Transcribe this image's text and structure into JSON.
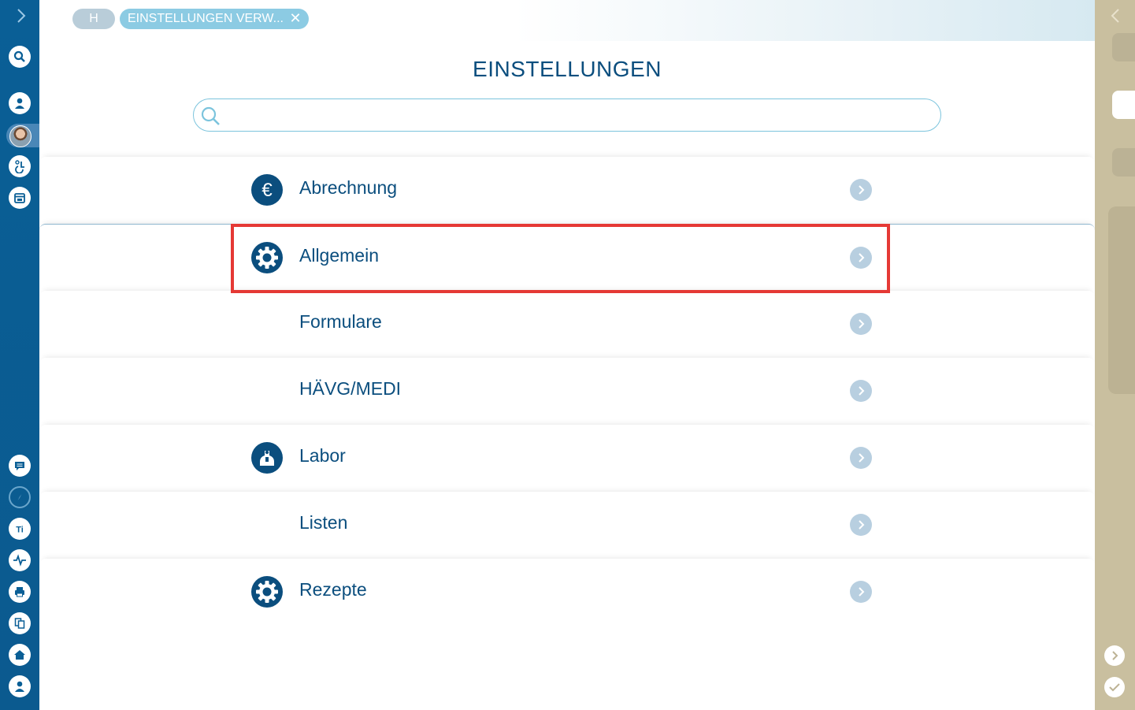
{
  "tabs": {
    "home_label": "H",
    "active_label": "EINSTELLUNGEN VERW...",
    "close_glyph": "✕"
  },
  "page": {
    "title": "EINSTELLUNGEN"
  },
  "search": {
    "value": "",
    "placeholder": ""
  },
  "settings_list": [
    {
      "label": "Abrechnung",
      "icon": "euro-icon"
    },
    {
      "label": "Allgemein",
      "icon": "gear-icon"
    },
    {
      "label": "Formulare",
      "icon": ""
    },
    {
      "label": "HÄVG/MEDI",
      "icon": ""
    },
    {
      "label": "Labor",
      "icon": "lab-flask-icon"
    },
    {
      "label": "Listen",
      "icon": ""
    },
    {
      "label": "Rezepte",
      "icon": "gear-icon"
    }
  ],
  "sidebar_icons": [
    "expand-chevron-icon",
    "search-icon",
    "patient-icon",
    "user-avatar",
    "wheelchair-icon",
    "calendar-icon",
    "chat-icon",
    "compass-icon",
    "ti-icon",
    "pulse-icon",
    "printer-icon",
    "documents-icon",
    "home-icon",
    "user-icon"
  ],
  "colors": {
    "sidebar": "#0a5f96",
    "accent": "#0b4e7e",
    "highlight": "#e53935",
    "right_panel": "#c9bf9f"
  }
}
